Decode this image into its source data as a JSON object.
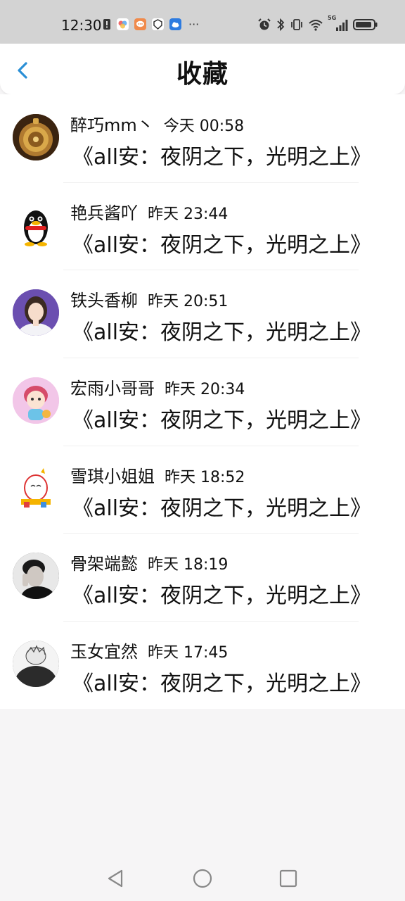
{
  "status_bar": {
    "time": "12:30",
    "notification_icons": [
      "alert-icon",
      "gallery-app-icon",
      "message-app-icon",
      "shield-app-icon",
      "cloud-app-icon"
    ],
    "more": "···",
    "right_icons": [
      "alarm-icon",
      "bluetooth-icon",
      "vibrate-icon",
      "wifi-icon",
      "5g-signal-icon",
      "battery-icon"
    ],
    "network_label": "5G"
  },
  "header": {
    "title": "收藏",
    "accent_color": "#2a8fd6"
  },
  "items": [
    {
      "user": "醉巧mm丶",
      "time": "今天 00:58",
      "title": "《all安：夜阴之下，光明之上》",
      "avatar_color": "#7a4a20",
      "avatar": "pocket-watch-avatar"
    },
    {
      "user": "艳兵酱吖",
      "time": "昨天 23:44",
      "title": "《all安：夜阴之下，光明之上》",
      "avatar_color": "#ffffff",
      "avatar": "penguin-avatar"
    },
    {
      "user": "铁头香柳",
      "time": "昨天 20:51",
      "title": "《all安：夜阴之下，光明之上》",
      "avatar_color": "#6b4fb0",
      "avatar": "girl-photo-avatar"
    },
    {
      "user": "宏雨小哥哥",
      "time": "昨天 20:34",
      "title": "《all安：夜阴之下，光明之上》",
      "avatar_color": "#f2c6e8",
      "avatar": "cartoon-boy-avatar"
    },
    {
      "user": "雪琪小姐姐",
      "time": "昨天 18:52",
      "title": "《all安：夜阴之下，光明之上》",
      "avatar_color": "#ffffff",
      "avatar": "cartoon-character-avatar"
    },
    {
      "user": "骨架端懿",
      "time": "昨天 18:19",
      "title": "《all安：夜阴之下，光明之上》",
      "avatar_color": "#2a2a2a",
      "avatar": "man-photo-avatar"
    },
    {
      "user": "玉女宜然",
      "time": "昨天 17:45",
      "title": "《all安：夜阴之下，光明之上》",
      "avatar_color": "#3a3a3a",
      "avatar": "anime-avatar"
    }
  ],
  "nav_bar": {
    "buttons": [
      "back-triangle-icon",
      "home-circle-icon",
      "recents-square-icon"
    ]
  }
}
